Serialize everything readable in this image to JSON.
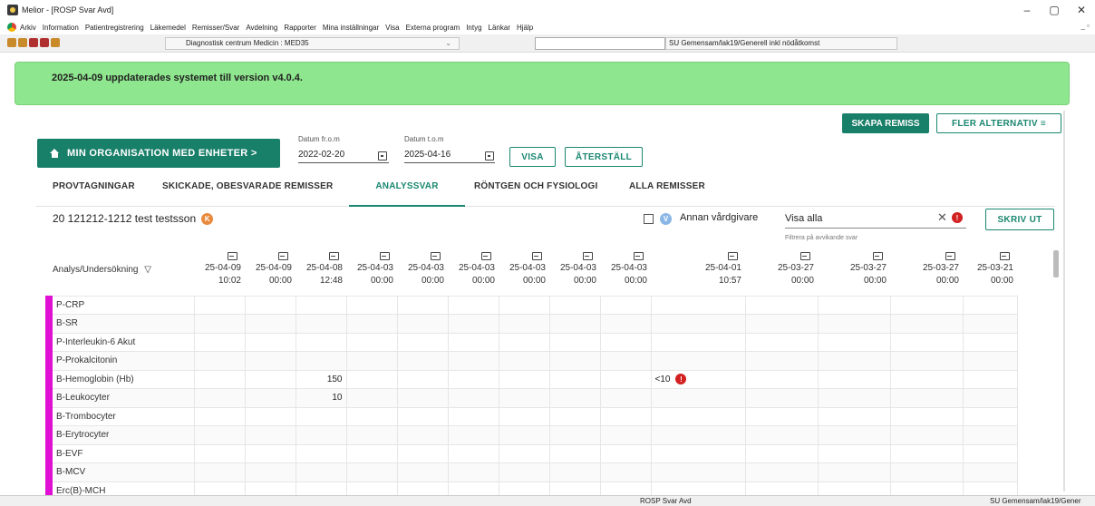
{
  "window": {
    "title": "Melior - [ROSP Svar Avd]",
    "controls": {
      "minimize": "–",
      "maximize": "▢",
      "close": "✕"
    }
  },
  "menu": {
    "items": [
      "Arkiv",
      "Information",
      "Patientregistrering",
      "Läkemedel",
      "Remisser/Svar",
      "Avdelning",
      "Rapporter",
      "Mina inställningar",
      "Visa",
      "Externa program",
      "Intyg",
      "Länkar",
      "Hjälp"
    ],
    "mdi_controls": "_ ▫"
  },
  "toolbar": {
    "department": "Diagnostisk centrum Medicin : MED35",
    "user_unit": "SU Gemensam/lak19/Generell inkl nödåtkomst"
  },
  "banner": {
    "text": "2025-04-09 uppdaterades systemet till version v4.0.4."
  },
  "actions": {
    "create_referral": "SKAPA REMISS",
    "more_options": "FLER ALTERNATIV ≡",
    "org_button": "MIN ORGANISATION MED ENHETER >",
    "date_from_label": "Datum fr.o.m",
    "date_from": "2022-02-20",
    "date_to_label": "Datum t.o.m",
    "date_to": "2025-04-16",
    "show": "VISA",
    "reset": "ÅTERSTÄLL"
  },
  "tabs": [
    {
      "label": "PROVTAGNINGAR",
      "active": false
    },
    {
      "label": "SKICKADE, OBESVARADE REMISSER",
      "active": false
    },
    {
      "label": "ANALYSSVAR",
      "active": true
    },
    {
      "label": "RÖNTGEN OCH FYSIOLOGI",
      "active": false
    },
    {
      "label": "ALLA REMISSER",
      "active": false
    }
  ],
  "patient": {
    "id_name": "20 121212-1212 test testsson",
    "badge": "K"
  },
  "filters": {
    "other_provider_badge": "V",
    "other_provider": "Annan vårdgivare",
    "show_value": "Visa alla",
    "clear": "✕",
    "alert": "!",
    "help": "Filtrera på avvikande svar",
    "print": "SKRIV UT"
  },
  "grid": {
    "first_header": "Analys/Undersökning",
    "filter_icon": "▽",
    "columns": [
      {
        "date": "25-04-09",
        "time": "10:02"
      },
      {
        "date": "25-04-09",
        "time": "00:00"
      },
      {
        "date": "25-04-08",
        "time": "12:48"
      },
      {
        "date": "25-04-03",
        "time": "00:00"
      },
      {
        "date": "25-04-03",
        "time": "00:00"
      },
      {
        "date": "25-04-03",
        "time": "00:00"
      },
      {
        "date": "25-04-03",
        "time": "00:00"
      },
      {
        "date": "25-04-03",
        "time": "00:00"
      },
      {
        "date": "25-04-03",
        "time": "00:00"
      },
      {
        "date": "25-04-01",
        "time": "10:57"
      },
      {
        "date": "25-03-27",
        "time": "00:00"
      },
      {
        "date": "25-03-27",
        "time": "00:00"
      },
      {
        "date": "25-03-27",
        "time": "00:00"
      },
      {
        "date": "25-03-21",
        "time": "00:00"
      }
    ],
    "rows": [
      {
        "name": "P-CRP",
        "values": {}
      },
      {
        "name": "B-SR",
        "values": {}
      },
      {
        "name": "P-Interleukin-6 Akut",
        "values": {}
      },
      {
        "name": "P-Prokalcitonin",
        "values": {}
      },
      {
        "name": "B-Hemoglobin (Hb)",
        "values": {
          "2": "150",
          "9": "<10"
        },
        "alerts": {
          "9": "!"
        }
      },
      {
        "name": "B-Leukocyter",
        "values": {
          "2": "10"
        }
      },
      {
        "name": "B-Trombocyter",
        "values": {}
      },
      {
        "name": "B-Erytrocyter",
        "values": {}
      },
      {
        "name": "B-EVF",
        "values": {}
      },
      {
        "name": "B-MCV",
        "values": {}
      },
      {
        "name": "Erc(B)-MCH",
        "values": {}
      }
    ]
  },
  "status": {
    "left": "ROSP Svar Avd",
    "right": "SU Gemensam/lak19/Gener"
  }
}
